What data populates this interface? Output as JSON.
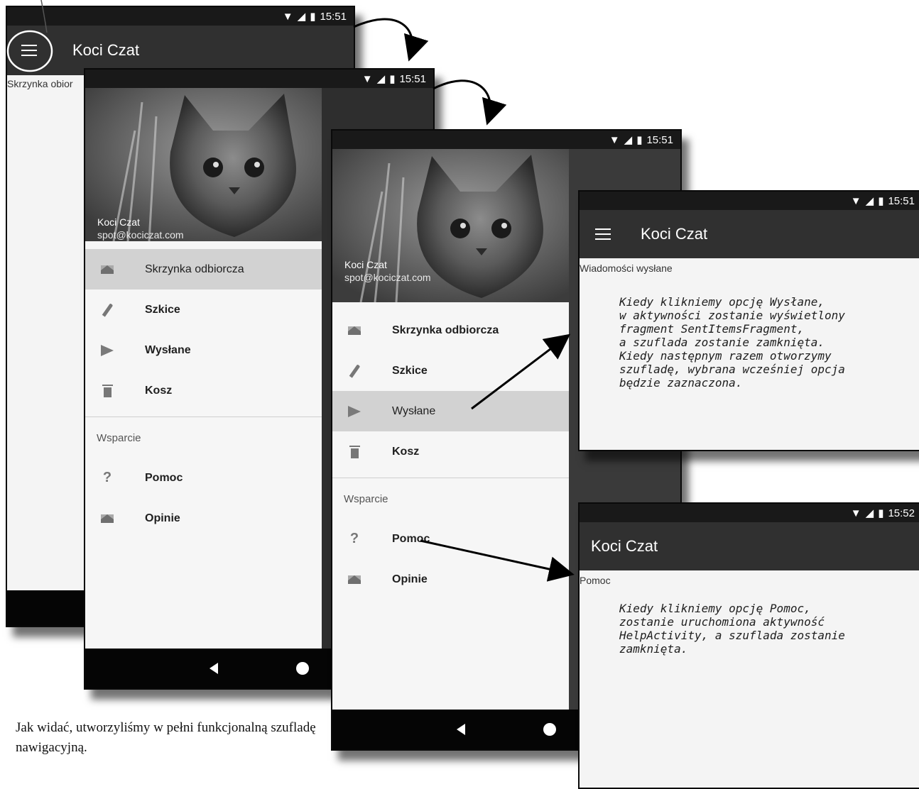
{
  "status": {
    "time_a": "15:51",
    "time_b": "15:52"
  },
  "app": {
    "title": "Koci Czat"
  },
  "screen1": {
    "content_label": "Skrzynka obior"
  },
  "drawer": {
    "header_name": "Koci Czat",
    "header_email": "spot@kociczat.com",
    "items": [
      {
        "label": "Skrzynka odbiorcza",
        "icon": "envelope-icon"
      },
      {
        "label": "Szkice",
        "icon": "pencil-icon"
      },
      {
        "label": "Wysłane",
        "icon": "send-icon"
      },
      {
        "label": "Kosz",
        "icon": "trash-icon"
      }
    ],
    "section": "Wsparcie",
    "support_items": [
      {
        "label": "Pomoc",
        "icon": "question-icon"
      },
      {
        "label": "Opinie",
        "icon": "envelope-icon"
      }
    ]
  },
  "screen4": {
    "content_label": "Wiadomości wysłane"
  },
  "screen5": {
    "content_label": "Pomoc"
  },
  "notes": {
    "sent": "Kiedy klikniemy opcję Wysłane,\nw aktywności zostanie wyświetlony\nfragment SentItemsFragment,\na szuflada zostanie zamknięta.\nKiedy następnym razem otworzymy\nszufladę, wybrana wcześniej opcja\nbędzie zaznaczona.",
    "help": "Kiedy klikniemy opcję Pomoc,\nzostanie uruchomiona aktywność\nHelpActivity, a szuflada zostanie\nzamknięta."
  },
  "caption": "Jak widać, utworzyliśmy w pełni funkcjonalną szufladę nawigacyjną.",
  "colors": {
    "appbar": "#303030",
    "statusbar": "#191919",
    "selected": "#d2d2d2"
  }
}
